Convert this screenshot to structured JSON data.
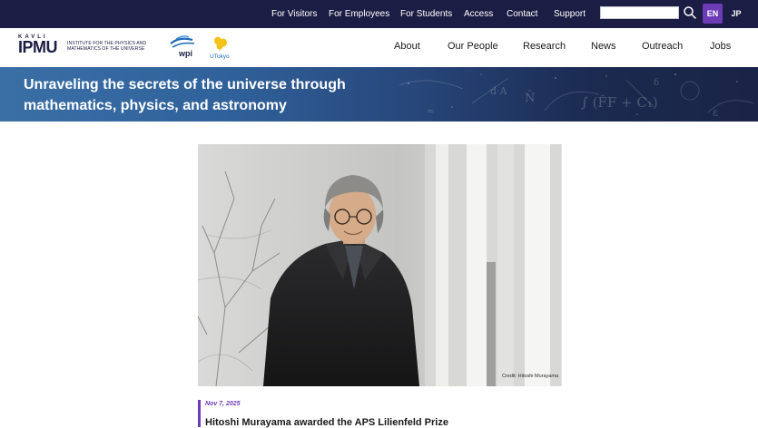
{
  "utility_nav": {
    "links": [
      "For Visitors",
      "For Employees",
      "For Students",
      "Access",
      "Contact",
      "Support"
    ],
    "search_placeholder": "",
    "languages": [
      "EN",
      "JP"
    ],
    "active_language": "EN"
  },
  "logo": {
    "kavli": "KAVLI",
    "ipmu": "IPMU",
    "institute_line1": "INSTITUTE FOR THE PHYSICS AND",
    "institute_line2": "MATHEMATICS OF THE UNIVERSE",
    "wpi": "wpi",
    "utokyo": "UTokyo"
  },
  "main_nav": {
    "items": [
      "About",
      "Our People",
      "Research",
      "News",
      "Outreach",
      "Jobs"
    ]
  },
  "hero": {
    "title": "Unraveling the secrets of the universe through mathematics, physics, and astronomy"
  },
  "article": {
    "photo_credit": "Credit: Hitoshi Murayama",
    "date": "Nov 7, 2025",
    "title": "Hitoshi Murayama awarded the APS Lilienfeld Prize"
  },
  "colors": {
    "topbar_bg": "#1c1d44",
    "accent_purple": "#6d3bb5",
    "hero_blue": "#30619a"
  },
  "icons": {
    "search": "search-icon",
    "wpi_logo": "wpi-logo-icon",
    "utokyo_logo": "utokyo-logo-icon"
  }
}
